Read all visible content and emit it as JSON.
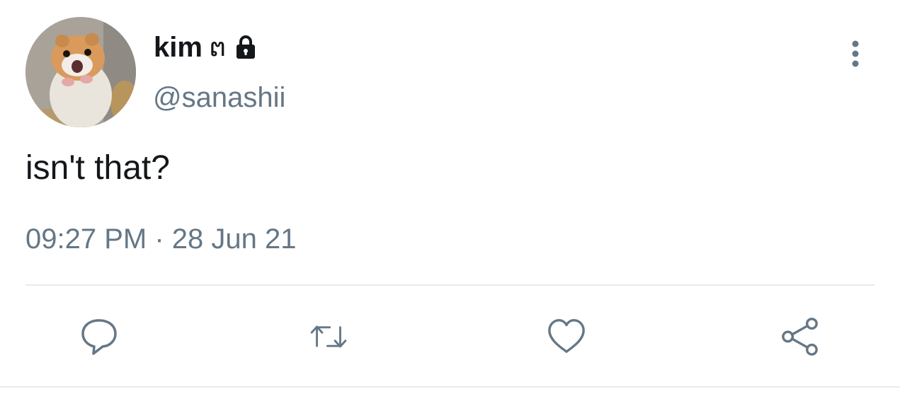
{
  "tweet": {
    "display_name": "kim",
    "name_glyph": "ຕ",
    "handle": "@sanashii",
    "text": "isn't that?",
    "timestamp": "09:27 PM · 28 Jun 21"
  },
  "icons": {
    "avatar": "hamster-avatar",
    "lock": "lock-icon",
    "more": "more-vertical-icon",
    "reply": "reply-icon",
    "retweet": "retweet-icon",
    "like": "heart-icon",
    "share": "share-icon"
  },
  "colors": {
    "primary_text": "#14171a",
    "secondary_text": "#657786",
    "divider": "#e6ecf0",
    "icon": "#657786"
  }
}
